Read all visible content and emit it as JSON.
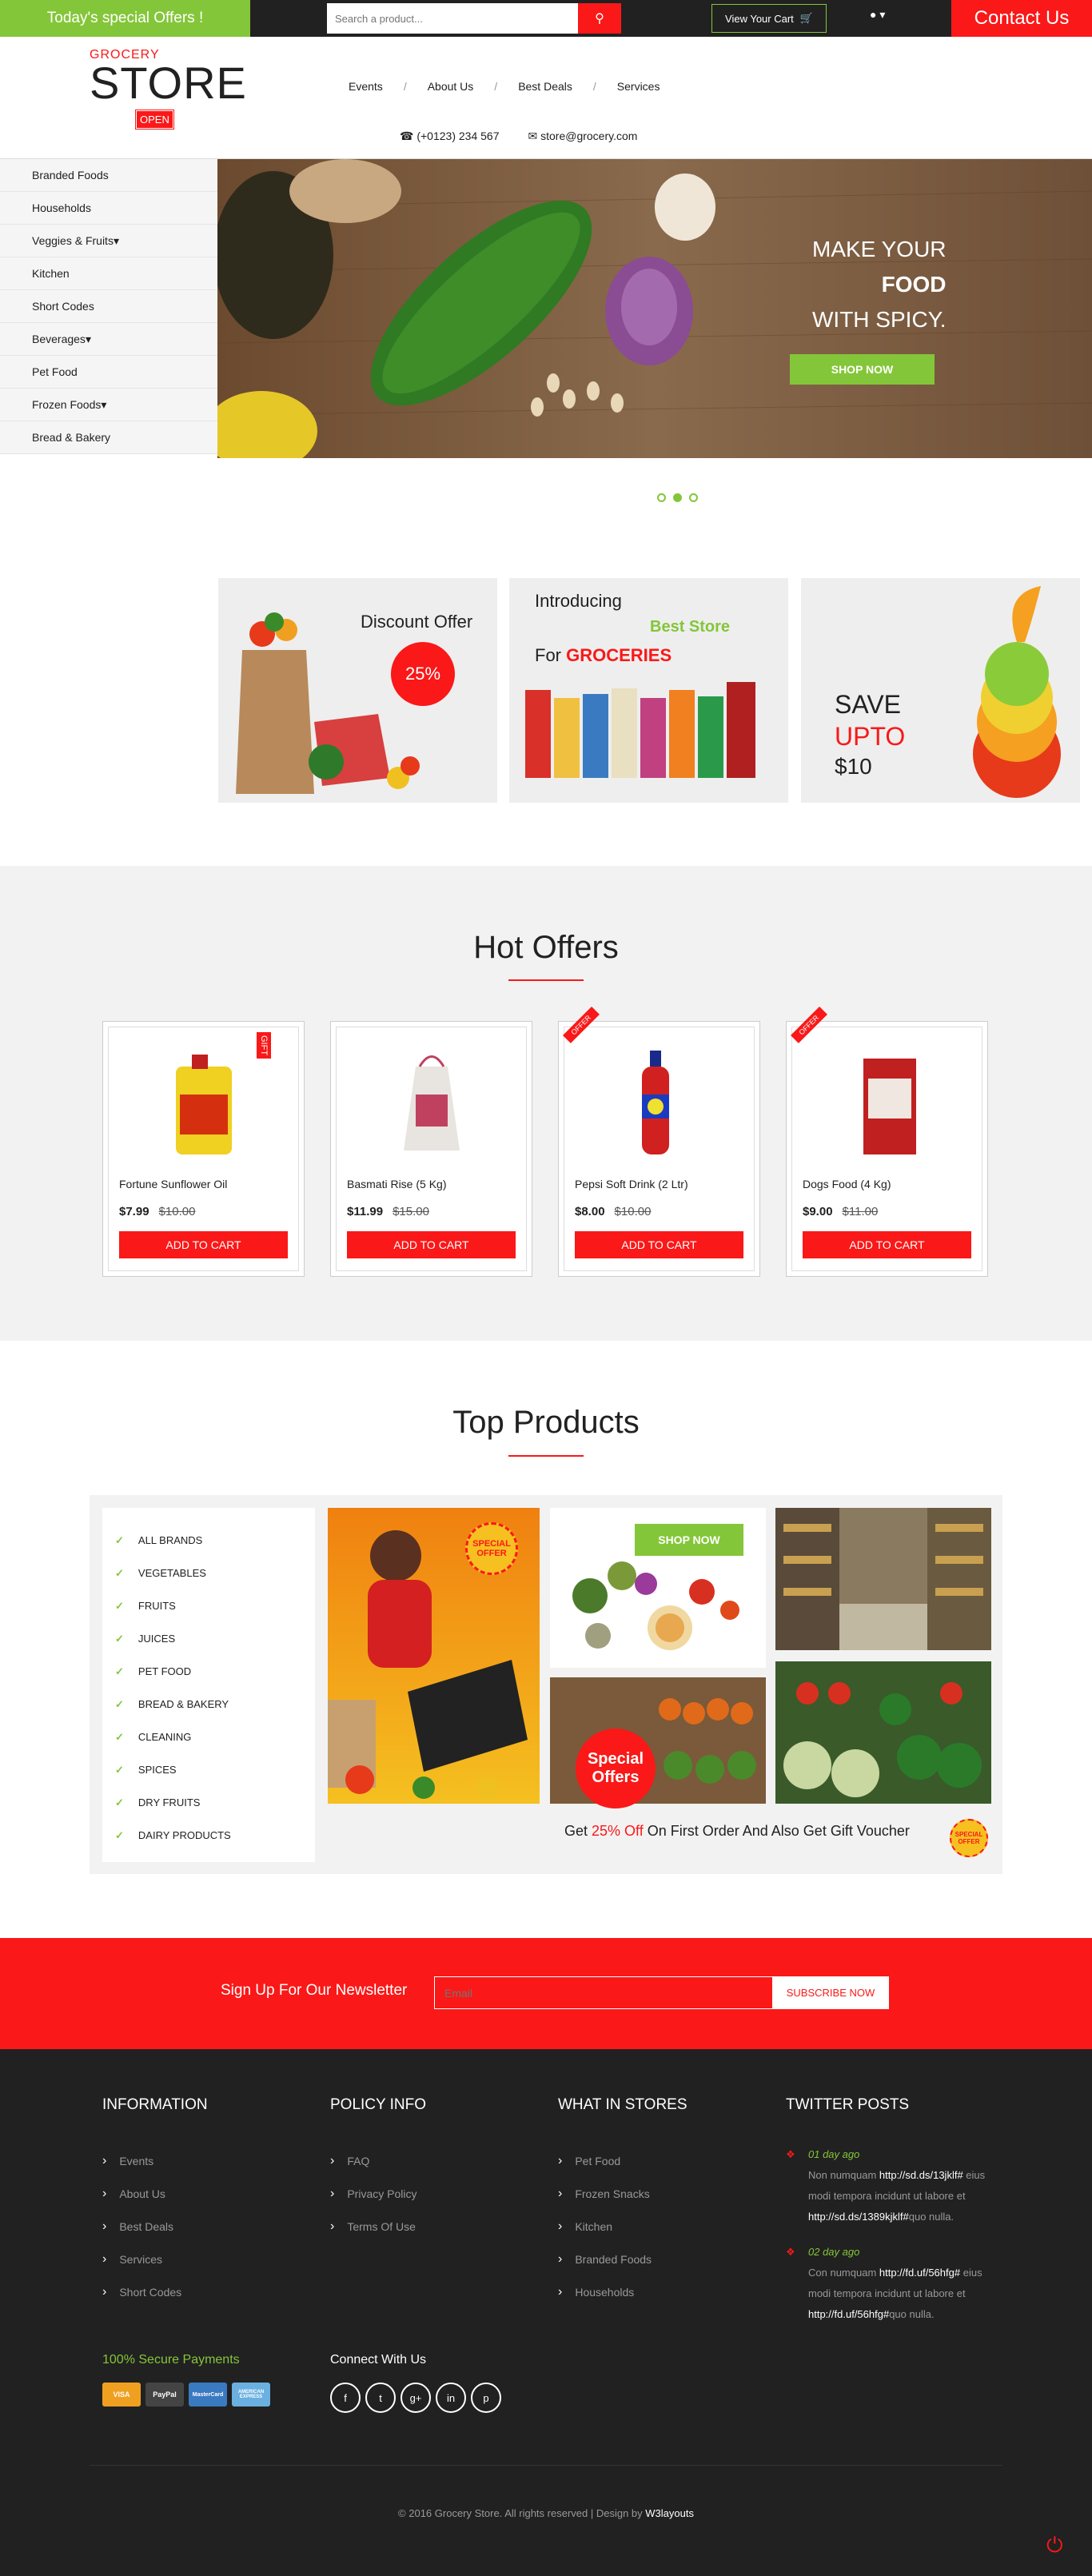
{
  "header": {
    "special_offers": "Today's special Offers !",
    "search_placeholder": "Search a product...",
    "view_cart": "View Your Cart",
    "contact_us": "Contact Us",
    "logo_small": "GROCERY",
    "logo_big": "STORE",
    "logo_sign": "OPEN"
  },
  "nav": [
    "Events",
    "About Us",
    "Best Deals",
    "Services"
  ],
  "contacts": {
    "phone": "(+0123) 234 567",
    "email": "store@grocery.com"
  },
  "sidebar": [
    "Branded Foods",
    "Households",
    "Veggies & Fruits",
    "Kitchen",
    "Short Codes",
    "Beverages",
    "Pet Food",
    "Frozen Foods",
    "Bread & Bakery"
  ],
  "sidebar_dropdowns": [
    false,
    false,
    true,
    false,
    false,
    true,
    false,
    true,
    false
  ],
  "hero": {
    "line1": "MAKE YOUR",
    "line2": "FOOD",
    "line3": "WITH SPICY.",
    "cta": "SHOP NOW"
  },
  "promos": {
    "p1_title": "Discount Offer",
    "p1_badge": "25%",
    "p2_l1": "Introducing",
    "p2_l2": "Best Store",
    "p2_l3a": "For ",
    "p2_l3b": "GROCERIES",
    "p3_l1": "SAVE",
    "p3_l2": "UPTO",
    "p3_l3": "$10"
  },
  "hot_offers": {
    "title": "Hot Offers",
    "add_label": "ADD TO CART",
    "items": [
      {
        "name": "Fortune Sunflower Oil",
        "price": "$7.99",
        "old": "$10.00",
        "tag": "GIFT"
      },
      {
        "name": "Basmati Rise (5 Kg)",
        "price": "$11.99",
        "old": "$15.00",
        "tag": ""
      },
      {
        "name": "Pepsi Soft Drink (2 Ltr)",
        "price": "$8.00",
        "old": "$10.00",
        "tag": "OFFER"
      },
      {
        "name": "Dogs Food (4 Kg)",
        "price": "$9.00",
        "old": "$11.00",
        "tag": "OFFER"
      }
    ]
  },
  "top_products": {
    "title": "Top Products",
    "categories": [
      "ALL BRANDS",
      "VEGETABLES",
      "FRUITS",
      "JUICES",
      "PET FOOD",
      "BREAD & BAKERY",
      "CLEANING",
      "SPICES",
      "DRY FRUITS",
      "DAIRY PRODUCTS"
    ],
    "shop_now": "SHOP NOW",
    "special_offers": "Special Offers",
    "special_offer_badge": "SPECIAL OFFER",
    "voucher_a": "Get ",
    "voucher_b": "25% Off",
    "voucher_c": " On First Order And Also Get Gift Voucher"
  },
  "newsletter": {
    "label": "Sign Up For Our Newsletter",
    "placeholder": "Email",
    "button": "SUBSCRIBE NOW"
  },
  "footer": {
    "info_title": "INFORMATION",
    "info": [
      "Events",
      "About Us",
      "Best Deals",
      "Services",
      "Short Codes"
    ],
    "policy_title": "POLICY INFO",
    "policy": [
      "FAQ",
      "Privacy Policy",
      "Terms Of Use"
    ],
    "stores_title": "WHAT IN STORES",
    "stores": [
      "Pet Food",
      "Frozen Snacks",
      "Kitchen",
      "Branded Foods",
      "Households"
    ],
    "twitter_title": "TWITTER POSTS",
    "tweets": [
      {
        "day": "01 day ago",
        "t1": "Non numquam ",
        "u1": "http://sd.ds/13jklf#",
        "t2": "eius modi tempora incidunt ut labore et ",
        "u2": "http://sd.ds/1389kjklf#",
        "t3": "quo nulla."
      },
      {
        "day": "02 day ago",
        "t1": "Con numquam ",
        "u1": "http://fd.uf/56hfg#",
        "t2": "eius modi tempora incidunt ut labore et ",
        "u2": "http://fd.uf/56hfg#",
        "t3": "quo nulla."
      }
    ],
    "secure": "100% Secure Payments",
    "payment_cards": [
      "VISA",
      "PayPal",
      "MasterCard",
      "AMERICAN EXPRESS"
    ],
    "connect": "Connect With Us",
    "social": [
      "f",
      "t",
      "g+",
      "in",
      "p"
    ],
    "copyright": "© 2016 Grocery Store. All rights reserved | Design by ",
    "designer": "W3layouts"
  },
  "colors": {
    "green": "#84c639",
    "red": "#fa1818",
    "dark": "#212121",
    "gray": "#f2f2f2"
  }
}
